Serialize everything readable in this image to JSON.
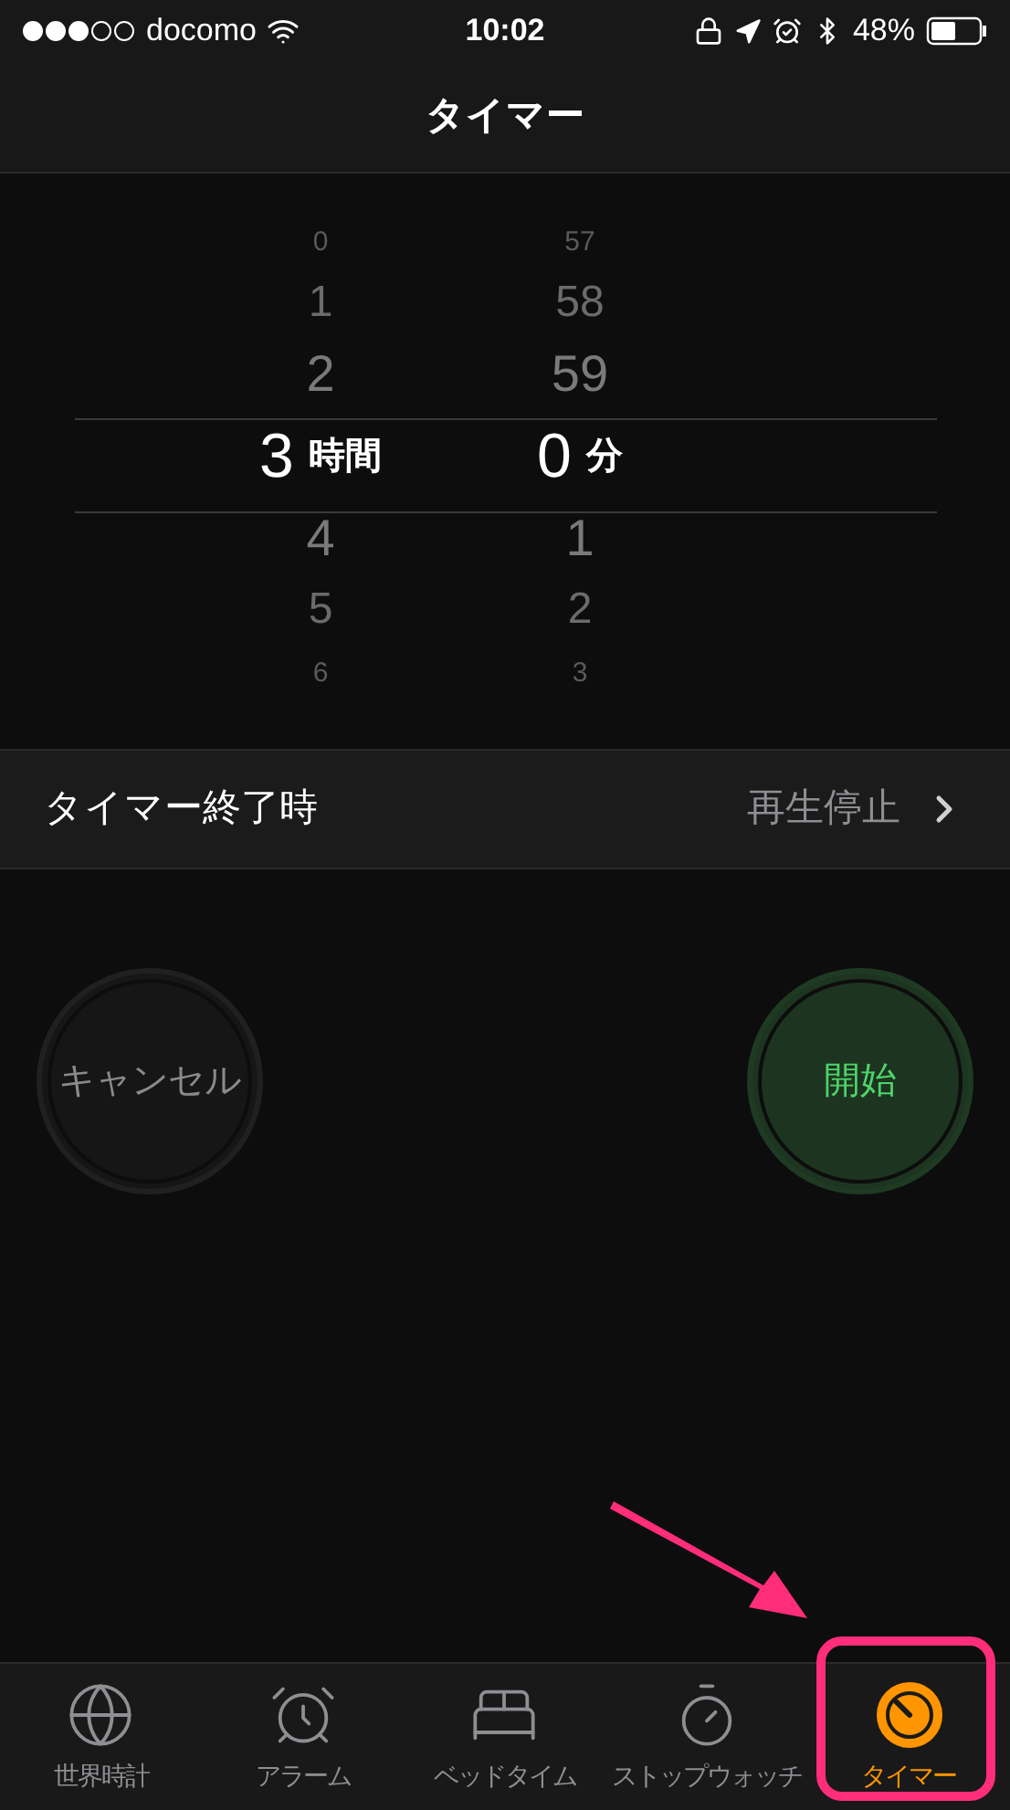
{
  "status_bar": {
    "carrier": "docomo",
    "time": "10:02",
    "battery": "48%"
  },
  "nav": {
    "title": "タイマー"
  },
  "picker": {
    "hours": [
      {
        "label": "0",
        "selected": false
      },
      {
        "label": "1",
        "selected": false
      },
      {
        "label": "2",
        "selected": false
      },
      {
        "label": "3",
        "selected": true
      },
      {
        "label": "4",
        "selected": false
      },
      {
        "label": "5",
        "selected": false
      },
      {
        "label": "6",
        "selected": false
      }
    ],
    "hours_unit": "時間",
    "minutes": [
      {
        "label": "57",
        "selected": false
      },
      {
        "label": "58",
        "selected": false
      },
      {
        "label": "59",
        "selected": false
      },
      {
        "label": "0",
        "selected": true
      },
      {
        "label": "1",
        "selected": false
      },
      {
        "label": "2",
        "selected": false
      },
      {
        "label": "3",
        "selected": false
      }
    ],
    "minutes_unit": "分"
  },
  "when_done": {
    "label": "タイマー終了時",
    "value": "再生停止"
  },
  "buttons": [
    {
      "kind": "cancel",
      "label": "キャンセル"
    },
    {
      "kind": "start",
      "label": "開始"
    }
  ],
  "tabs": [
    {
      "kind": "globe",
      "label": "世界時計",
      "selected": false
    },
    {
      "kind": "alarm",
      "label": "アラーム",
      "selected": false
    },
    {
      "kind": "bed",
      "label": "ベッドタイム",
      "selected": false
    },
    {
      "kind": "stopwatch",
      "label": "ストップウォッチ",
      "selected": false
    },
    {
      "kind": "timer",
      "label": "タイマー",
      "selected": true
    }
  ]
}
